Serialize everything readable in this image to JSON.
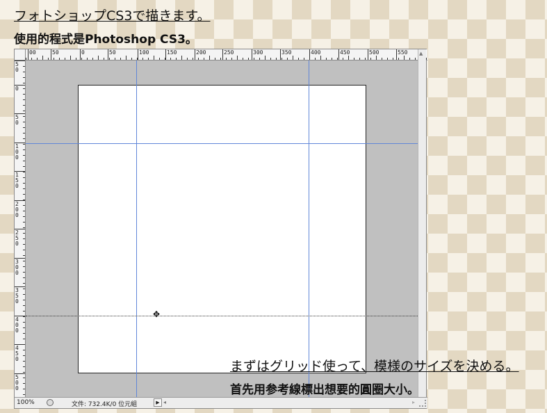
{
  "captions": {
    "top_ja": "フォトショップCS3で描きます。",
    "top_zh": "使用的程式是Photoshop CS3。",
    "bottom_ja": "まずはグリッド使って、模様のサイズを決める。",
    "bottom_zh": "首先用参考線標出想要的圓圈大小。"
  },
  "ruler": {
    "top_labels": [
      "00",
      "50",
      "0",
      "50",
      "100",
      "150",
      "200",
      "250",
      "300",
      "350",
      "400",
      "450",
      "500",
      "550"
    ],
    "left_labels": [
      "50",
      "0",
      "50",
      "100",
      "150",
      "200",
      "250",
      "300",
      "350",
      "400",
      "450",
      "500"
    ]
  },
  "status": {
    "zoom": "100%",
    "doc_info": "文件: 732.4K/0 位元組",
    "arrow": "▶",
    "scroll_left": "◂",
    "scroll_right": "▸",
    "scroll_up": "▲"
  },
  "icons": {
    "cursor": "move-cursor-icon",
    "status": "status-circle-icon"
  },
  "colors": {
    "guide": "#5f86d8",
    "pasteboard": "#c0c0c0"
  }
}
